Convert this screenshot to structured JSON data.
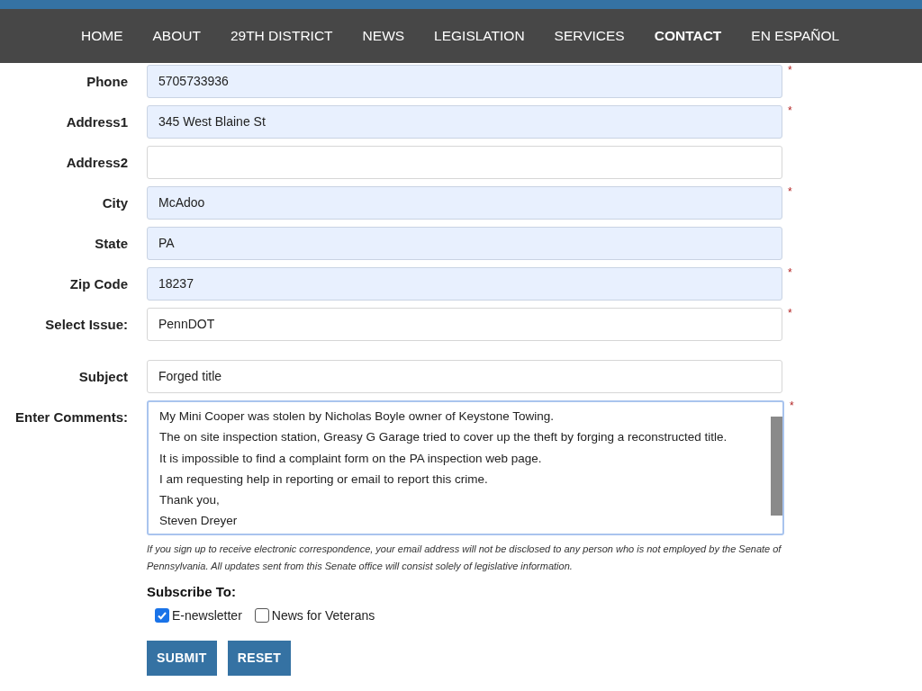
{
  "nav": [
    {
      "label": "HOME",
      "selected": false
    },
    {
      "label": "ABOUT",
      "selected": false
    },
    {
      "label": "29TH DISTRICT",
      "selected": false
    },
    {
      "label": "NEWS",
      "selected": false
    },
    {
      "label": "LEGISLATION",
      "selected": false
    },
    {
      "label": "SERVICES",
      "selected": false
    },
    {
      "label": "CONTACT",
      "selected": true
    },
    {
      "label": "EN ESPAÑOL",
      "selected": false
    }
  ],
  "fields": [
    {
      "kind": "text",
      "label": "Phone",
      "value": "5705733936",
      "autofilled": true,
      "required_mark": "*"
    },
    {
      "kind": "text",
      "label": "Address1",
      "value": "345 West Blaine St",
      "autofilled": true,
      "required_mark": "*"
    },
    {
      "kind": "text",
      "label": "Address2",
      "autofilled": false
    },
    {
      "kind": "text",
      "label": "City",
      "value": "McAdoo",
      "autofilled": true,
      "required_mark": "*"
    },
    {
      "kind": "text",
      "label": "State",
      "value": "PA",
      "autofilled": true
    },
    {
      "kind": "text",
      "label": "Zip Code",
      "value": "18237",
      "autofilled": true,
      "required_mark": "*"
    },
    {
      "kind": "select",
      "label": "Select Issue:",
      "value": "PennDOT",
      "autofilled": false,
      "required_mark": "*"
    },
    {
      "kind": "text",
      "label": "Subject",
      "value": "Forged title",
      "autofilled": false
    },
    {
      "kind": "textarea",
      "label": "Enter Comments:",
      "lines": [
        "My Mini Cooper was stolen by Nicholas Boyle owner of Keystone Towing.",
        "The on site inspection station, Greasy G Garage tried to cover up the theft by forging a reconstructed title.",
        "It is impossible to find a complaint form on the PA inspection web page.",
        "I am requesting help in reporting or email to report this crime.",
        "Thank you,",
        "Steven Dreyer"
      ],
      "autofilled": false,
      "required_mark": "*"
    }
  ],
  "notice": "If you sign up to receive electronic correspondence, your email address will not be disclosed to any person who is not employed by the Senate of Pennsylvania. All updates sent from this Senate office will consist solely of legislative information.",
  "subscribe": {
    "title": "Subscribe To:",
    "options": [
      {
        "label": "E-newsletter",
        "checked": true
      },
      {
        "label": "News for Veterans",
        "checked": false
      }
    ]
  },
  "buttons": [
    "SUBMIT",
    "RESET"
  ]
}
